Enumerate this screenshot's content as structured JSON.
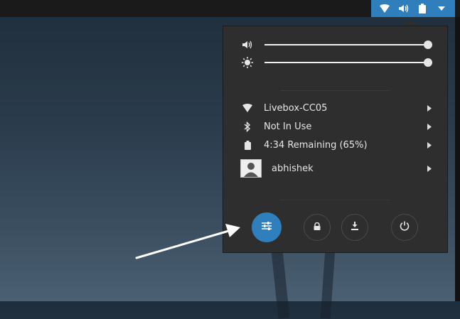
{
  "topbar": {
    "indicators": [
      "wifi-icon",
      "volume-icon",
      "battery-icon",
      "dropdown-icon"
    ],
    "accent": "#2f7fbd"
  },
  "menu": {
    "sliders": {
      "volume": {
        "icon": "volume-icon",
        "level": 1.0
      },
      "brightness": {
        "icon": "brightness-icon",
        "level": 1.0
      }
    },
    "items": [
      {
        "icon": "wifi-icon",
        "label": "Livebox-CC05"
      },
      {
        "icon": "bluetooth-icon",
        "label": "Not In Use"
      },
      {
        "icon": "battery-icon",
        "label": "4:34 Remaining (65%)"
      },
      {
        "icon": "avatar",
        "label": "abhishek"
      }
    ],
    "buttons": [
      "settings-icon",
      "lock-icon",
      "suspend-icon",
      "power-icon"
    ]
  },
  "colors": {
    "menu_bg": "#2e2e2e",
    "topbar_bg": "#1a1a1a",
    "accent": "#2f7fbd"
  }
}
